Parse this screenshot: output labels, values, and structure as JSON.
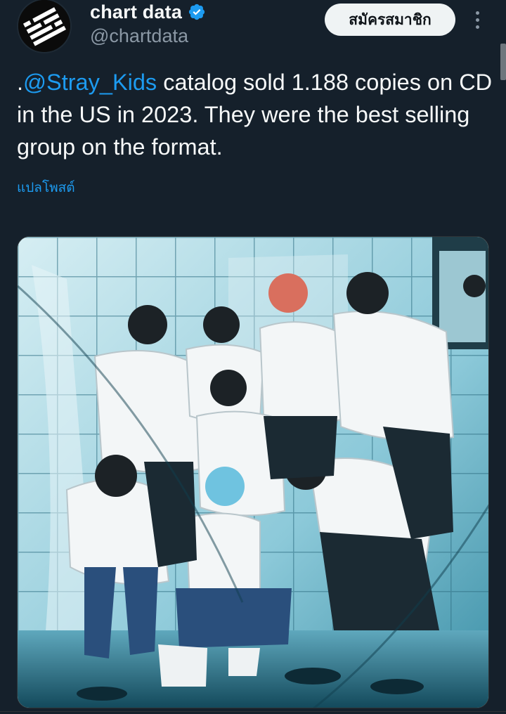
{
  "post": {
    "author": {
      "display_name": "chart data",
      "handle": "@chartdata",
      "verified_icon": "verified-badge-icon",
      "avatar_icon": "chart-data-logo-icon"
    },
    "actions": {
      "subscribe_label": "สมัครสมาชิก",
      "more_icon": "more-options-icon"
    },
    "text": {
      "prefix": ".",
      "mention": "@Stray_Kids",
      "body": " catalog sold 1.188 copies on CD in the US in 2023. They were the best selling group on the format."
    },
    "translate_label": "แปลโพสต์"
  },
  "colors": {
    "background": "#15202b",
    "text_primary": "#f7f9f9",
    "text_secondary": "#8b98a5",
    "link": "#1d9bf0",
    "button_bg": "#eff3f4",
    "button_text": "#0f1419"
  }
}
